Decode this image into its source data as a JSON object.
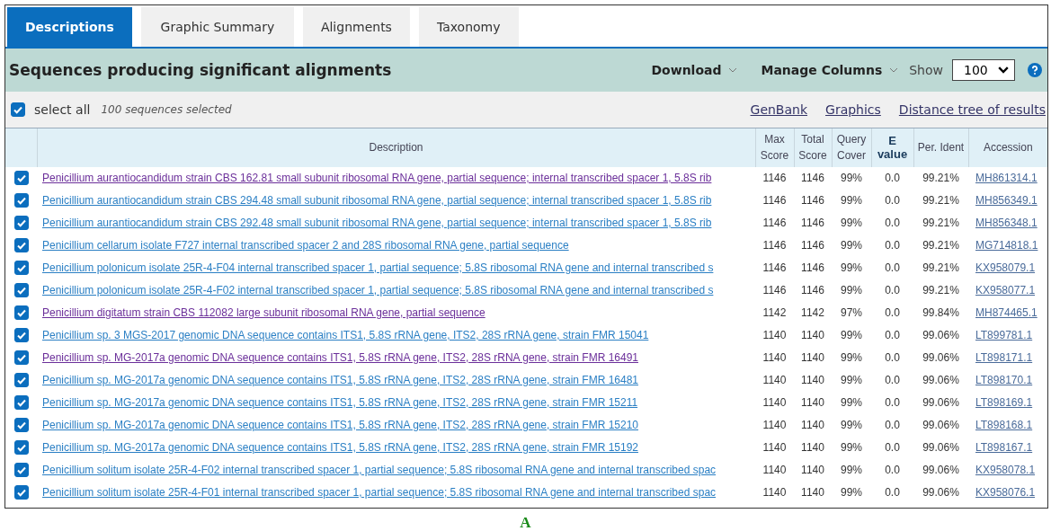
{
  "tabs": [
    {
      "label": "Descriptions",
      "selected": true
    },
    {
      "label": "Graphic Summary",
      "selected": false
    },
    {
      "label": "Alignments",
      "selected": false
    },
    {
      "label": "Taxonomy",
      "selected": false
    }
  ],
  "header": {
    "title": "Sequences producing significant alignments",
    "download": "Download",
    "manage_columns": "Manage Columns",
    "show_label": "Show",
    "show_value": "100"
  },
  "selection": {
    "label": "select all",
    "checked": true,
    "count": "100 sequences selected",
    "links": [
      "GenBank",
      "Graphics",
      "Distance tree of results"
    ]
  },
  "table": {
    "columns": [
      "Description",
      "Max Score",
      "Total Score",
      "Query Cover",
      "E value",
      "Per. Ident",
      "Accession"
    ],
    "rows": [
      {
        "checked": true,
        "visited": true,
        "description": "Penicillium aurantiocandidum strain CBS 162.81 small subunit ribosomal RNA gene, partial sequence; internal transcribed spacer 1, 5.8S rib",
        "max_score": "1146",
        "total_score": "1146",
        "query_cover": "99%",
        "e_value": "0.0",
        "per_ident": "99.21%",
        "accession": "MH861314.1"
      },
      {
        "checked": true,
        "visited": false,
        "description": "Penicillium aurantiocandidum strain CBS 294.48 small subunit ribosomal RNA gene, partial sequence; internal transcribed spacer 1, 5.8S rib",
        "max_score": "1146",
        "total_score": "1146",
        "query_cover": "99%",
        "e_value": "0.0",
        "per_ident": "99.21%",
        "accession": "MH856349.1"
      },
      {
        "checked": true,
        "visited": false,
        "description": "Penicillium aurantiocandidum strain CBS 292.48 small subunit ribosomal RNA gene, partial sequence; internal transcribed spacer 1, 5.8S rib",
        "max_score": "1146",
        "total_score": "1146",
        "query_cover": "99%",
        "e_value": "0.0",
        "per_ident": "99.21%",
        "accession": "MH856348.1"
      },
      {
        "checked": true,
        "visited": false,
        "description": "Penicillium cellarum isolate F727 internal transcribed spacer 2 and 28S ribosomal RNA gene, partial sequence",
        "max_score": "1146",
        "total_score": "1146",
        "query_cover": "99%",
        "e_value": "0.0",
        "per_ident": "99.21%",
        "accession": "MG714818.1"
      },
      {
        "checked": true,
        "visited": false,
        "description": "Penicillium polonicum isolate 25R-4-F04 internal transcribed spacer 1, partial sequence; 5.8S ribosomal RNA gene and internal transcribed s",
        "max_score": "1146",
        "total_score": "1146",
        "query_cover": "99%",
        "e_value": "0.0",
        "per_ident": "99.21%",
        "accession": "KX958079.1"
      },
      {
        "checked": true,
        "visited": false,
        "description": "Penicillium polonicum isolate 25R-4-F02 internal transcribed spacer 1, partial sequence; 5.8S ribosomal RNA gene and internal transcribed s",
        "max_score": "1146",
        "total_score": "1146",
        "query_cover": "99%",
        "e_value": "0.0",
        "per_ident": "99.21%",
        "accession": "KX958077.1"
      },
      {
        "checked": true,
        "visited": true,
        "description": "Penicillium digitatum strain CBS 112082 large subunit ribosomal RNA gene, partial sequence",
        "max_score": "1142",
        "total_score": "1142",
        "query_cover": "97%",
        "e_value": "0.0",
        "per_ident": "99.84%",
        "accession": "MH874465.1"
      },
      {
        "checked": true,
        "visited": false,
        "description": "Penicillium sp. 3 MGS-2017 genomic DNA sequence contains ITS1, 5.8S rRNA gene, ITS2, 28S rRNA gene, strain FMR 15041",
        "max_score": "1140",
        "total_score": "1140",
        "query_cover": "99%",
        "e_value": "0.0",
        "per_ident": "99.06%",
        "accession": "LT899781.1"
      },
      {
        "checked": true,
        "visited": true,
        "description": "Penicillium sp. MG-2017a genomic DNA sequence contains ITS1, 5.8S rRNA gene, ITS2, 28S rRNA gene, strain FMR 16491",
        "max_score": "1140",
        "total_score": "1140",
        "query_cover": "99%",
        "e_value": "0.0",
        "per_ident": "99.06%",
        "accession": "LT898171.1"
      },
      {
        "checked": true,
        "visited": false,
        "description": "Penicillium sp. MG-2017a genomic DNA sequence contains ITS1, 5.8S rRNA gene, ITS2, 28S rRNA gene, strain FMR 16481",
        "max_score": "1140",
        "total_score": "1140",
        "query_cover": "99%",
        "e_value": "0.0",
        "per_ident": "99.06%",
        "accession": "LT898170.1"
      },
      {
        "checked": true,
        "visited": false,
        "description": "Penicillium sp. MG-2017a genomic DNA sequence contains ITS1, 5.8S rRNA gene, ITS2, 28S rRNA gene, strain FMR 15211",
        "max_score": "1140",
        "total_score": "1140",
        "query_cover": "99%",
        "e_value": "0.0",
        "per_ident": "99.06%",
        "accession": "LT898169.1"
      },
      {
        "checked": true,
        "visited": false,
        "description": "Penicillium sp. MG-2017a genomic DNA sequence contains ITS1, 5.8S rRNA gene, ITS2, 28S rRNA gene, strain FMR 15210",
        "max_score": "1140",
        "total_score": "1140",
        "query_cover": "99%",
        "e_value": "0.0",
        "per_ident": "99.06%",
        "accession": "LT898168.1"
      },
      {
        "checked": true,
        "visited": false,
        "description": "Penicillium sp. MG-2017a genomic DNA sequence contains ITS1, 5.8S rRNA gene, ITS2, 28S rRNA gene, strain FMR 15192",
        "max_score": "1140",
        "total_score": "1140",
        "query_cover": "99%",
        "e_value": "0.0",
        "per_ident": "99.06%",
        "accession": "LT898167.1"
      },
      {
        "checked": true,
        "visited": false,
        "description": "Penicillium solitum isolate 25R-4-F02 internal transcribed spacer 1, partial sequence; 5.8S ribosomal RNA gene and internal transcribed spac",
        "max_score": "1140",
        "total_score": "1140",
        "query_cover": "99%",
        "e_value": "0.0",
        "per_ident": "99.06%",
        "accession": "KX958078.1"
      },
      {
        "checked": true,
        "visited": false,
        "description": "Penicillium solitum isolate 25R-4-F01 internal transcribed spacer 1, partial sequence; 5.8S ribosomal RNA gene and internal transcribed spac",
        "max_score": "1140",
        "total_score": "1140",
        "query_cover": "99%",
        "e_value": "0.0",
        "per_ident": "99.06%",
        "accession": "KX958076.1"
      }
    ]
  },
  "caption": "A"
}
